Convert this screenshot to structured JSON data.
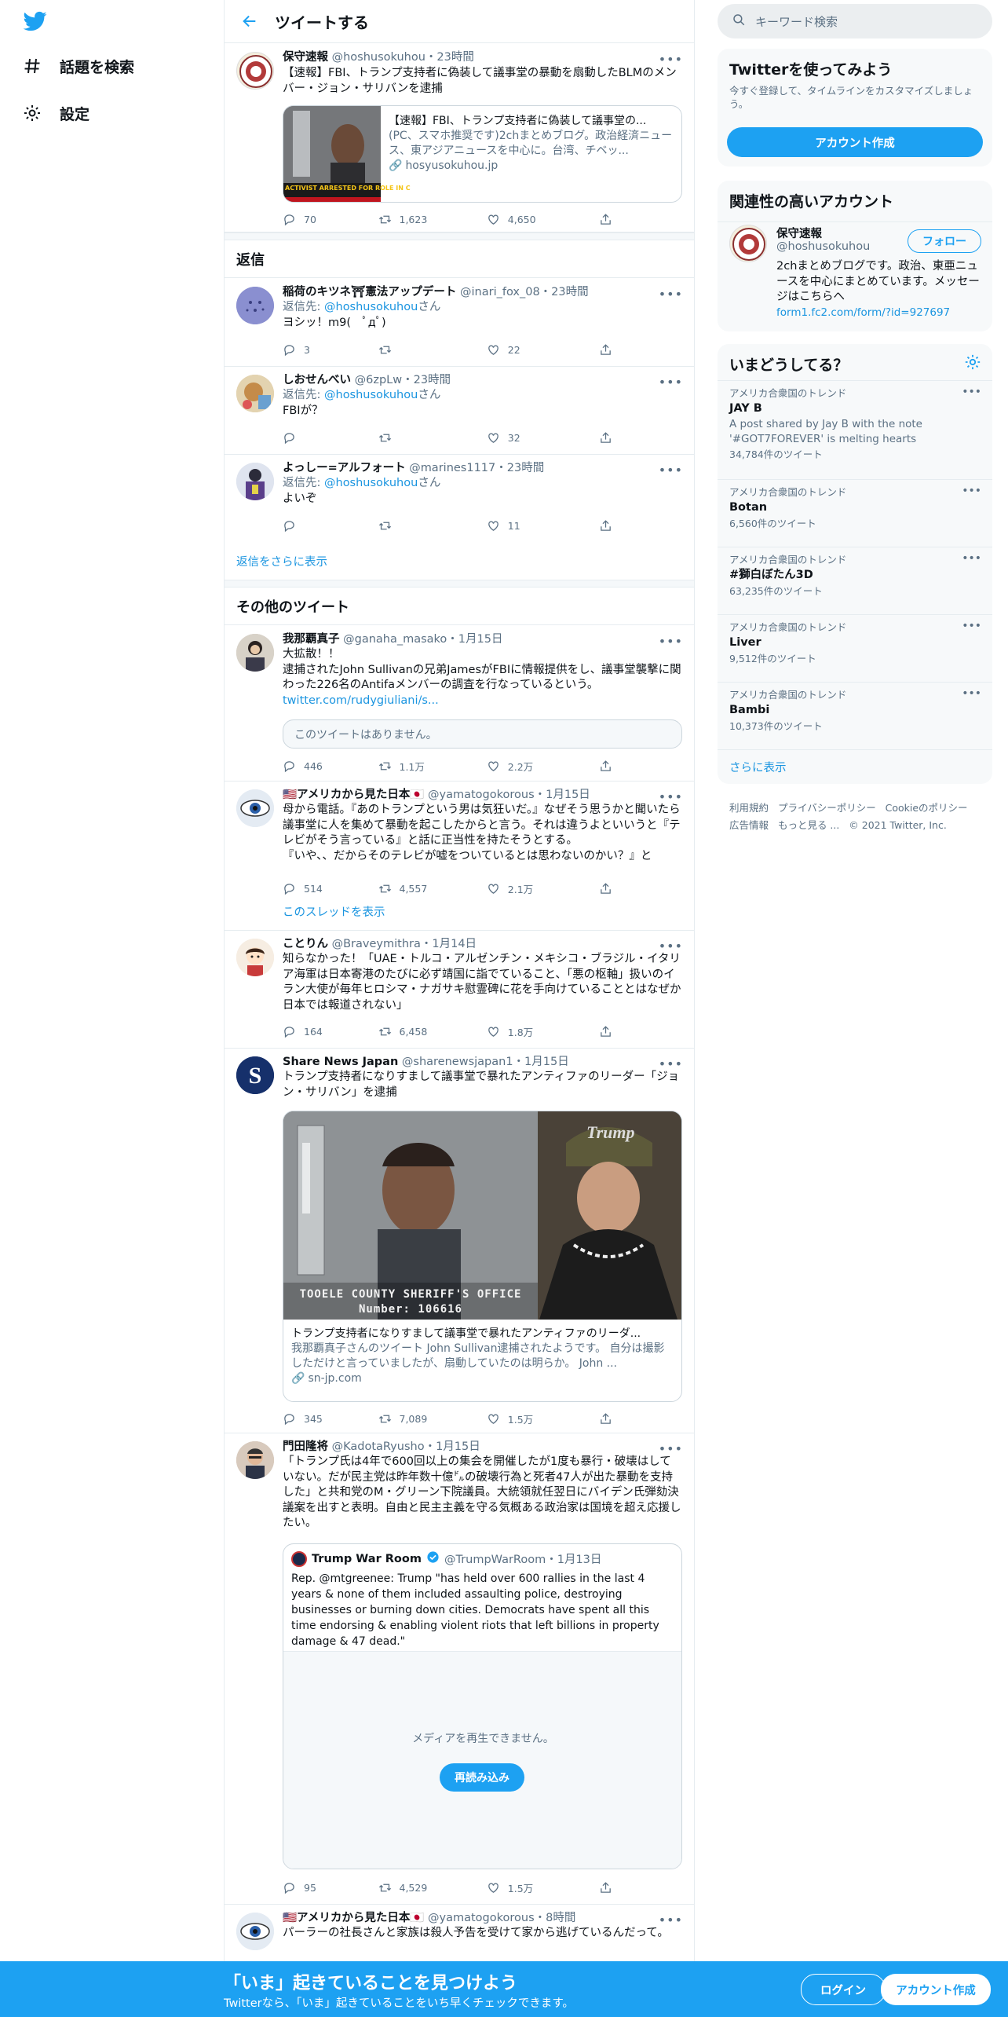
{
  "nav": {
    "explore": "話題を検索",
    "settings": "設定"
  },
  "header": {
    "title": "ツイートする"
  },
  "main_tweet": {
    "name": "保守速報",
    "handle": "@hoshusokuhou・23時間",
    "text": "【速報】FBI、トランプ支持者に偽装して議事堂の暴動を扇動したBLMのメンバー・ジョン・サリバンを逮捕",
    "card_title": "【速報】FBI、トランプ支持者に偽装して議事堂の...",
    "card_desc": "(PC、スマホ推奨です)2chまとめブログ。政治経済ニュース、東アジアニュースを中心に。台湾、チベッ...",
    "card_domain": "hosyusokuhou.jp",
    "card_image_caption": "ACTIVIST ARRESTED FOR ROLE IN C",
    "replies": "70",
    "retweets": "1,623",
    "likes": "4,650"
  },
  "replies_section": {
    "title": "返信",
    "show_more": "返信をさらに表示"
  },
  "replies": [
    {
      "name": "稲荷のキツネ⛩憲法アップデート",
      "handle": "@inari_fox_08・23時間",
      "reply_prefix": "返信先: ",
      "reply_to": "@hoshusokuhou",
      "reply_suffix": "さん",
      "text": "ヨシッ！m9(　ﾟдﾟ)",
      "replies": "3",
      "retweets": "",
      "likes": "22"
    },
    {
      "name": "しおせんべい",
      "handle": "@6zpLw・23時間",
      "reply_prefix": "返信先: ",
      "reply_to": "@hoshusokuhou",
      "reply_suffix": "さん",
      "text": "FBIが？",
      "replies": "",
      "retweets": "",
      "likes": "32"
    },
    {
      "name": "よっしー=アルフォート",
      "handle": "@marines1117・23時間",
      "reply_prefix": "返信先: ",
      "reply_to": "@hoshusokuhou",
      "reply_suffix": "さん",
      "text": "よいぞ",
      "replies": "",
      "retweets": "",
      "likes": "11"
    }
  ],
  "others_section": {
    "title": "その他のツイート"
  },
  "other_tweets": [
    {
      "name": "我那覇真子",
      "handle": "@ganaha_masako・1月15日",
      "text": "大拡散！！\n逮捕されたJohn Sullivanの兄弟JamesがFBIに情報提供をし、議事堂襲撃に関わった226名のAntifaメンバーの調査を行なっているという。",
      "link": "twitter.com/rudygiuliani/s...",
      "unavailable": "このツイートはありません。",
      "replies": "446",
      "retweets": "1.1万",
      "likes": "2.2万"
    },
    {
      "name": "🇺🇸アメリカから見た日本🇯🇵",
      "handle": "@yamatogokorous・1月15日",
      "text": "母から電話。『あのトランプという男は気狂いだ。』なぜそう思うかと聞いたら議事堂に人を集めて暴動を起こしたからと言う。それは違うよといいうと『テレビがそう言っている』と話に正当性を持たそうとする。\n『いや、、だからそのテレビが嘘をついているとは思わないのかい？』と",
      "replies": "514",
      "retweets": "4,557",
      "likes": "2.1万",
      "thread": "このスレッドを表示"
    },
    {
      "name": "ことりん",
      "handle": "@Braveymithra・1月14日",
      "text": "知らなかった！「UAE・トルコ・アルゼンチン・メキシコ・ブラジル・イタリア海軍は日本寄港のたびに必ず靖国に詣でていること、「悪の枢軸」扱いのイラン大使が毎年ヒロシマ・ナガサキ慰霊碑に花を手向けていることとはなぜか日本では報道されない」",
      "replies": "164",
      "retweets": "6,458",
      "likes": "1.8万"
    },
    {
      "name": "Share News Japan",
      "handle": "@sharenewsjapan1・1月15日",
      "text": "トランプ支持者になりすまして議事堂で暴れたアンティファのリーダー「ジョン・サリバン」を逮捕",
      "card_title": "トランプ支持者になりすまして議事堂で暴れたアンティファのリーダ...",
      "card_desc": "我那覇真子さんのツイート John Sullivan逮捕されたようです。 自分は撮影しただけと言っていましたが、扇動していたのは明らか。 John ...",
      "card_domain": "sn-jp.com",
      "mug_line1": "TOOELE COUNTY SHERIFF'S OFFICE",
      "mug_line2": "Number: 106616",
      "cap_text": "Trump",
      "replies": "345",
      "retweets": "7,089",
      "likes": "1.5万"
    },
    {
      "name": "門田隆将",
      "handle": "@KadotaRyusho・1月15日",
      "text": "「トランプ氏は4年で600回以上の集会を開催したが1度も暴行・破壊はしていない。だが民主党は昨年数十億㌦の破壊行為と死者47人が出た暴動を支持した」と共和党のM・グリーン下院議員。大統領就任翌日にバイデン氏弾劾決議案を出すと表明。自由と民主主義を守る気概ある政治家は国境を超え応援したい。",
      "quote_name": "Trump War Room",
      "quote_handle": "@TrumpWarRoom・1月13日",
      "quote_text": "Rep. @mtgreenee: Trump \"has held over 600 rallies in the last 4 years & none of them included assaulting police, destroying businesses or burning down cities. Democrats have spent all this time endorsing & enabling violent riots that left billions in property damage & 47 dead.\"",
      "media_error": "メディアを再生できません。",
      "reload": "再読み込み",
      "replies": "95",
      "retweets": "4,529",
      "likes": "1.5万"
    },
    {
      "name": "🇺🇸アメリカから見た日本🇯🇵",
      "handle": "@yamatogokorous・8時間",
      "text": "パーラーの社長さんと家族は殺人予告を受けて家から逃げているんだって。"
    }
  ],
  "search": {
    "placeholder": "キーワード検索"
  },
  "signup": {
    "title": "Twitterを使ってみよう",
    "desc": "今すぐ登録して、タイムラインをカスタマイズしましょう。",
    "button": "アカウント作成"
  },
  "related": {
    "title": "関連性の高いアカウント",
    "name": "保守速報",
    "handle": "@hoshusokuhou",
    "follow": "フォロー",
    "bio": "2chまとめブログです。政治、東亜ニュースを中心にまとめています。メッセージはこちらへ",
    "link": "form1.fc2.com/form/?id=927697"
  },
  "trends": {
    "title": "いまどうしてる？",
    "items": [
      {
        "context": "アメリカ合衆国のトレンド",
        "name": "JAY B",
        "desc": "A post shared by Jay B with the note '#GOT7FOREVER' is melting hearts",
        "count": "34,784件のツイート"
      },
      {
        "context": "アメリカ合衆国のトレンド",
        "name": "Botan",
        "count": "6,560件のツイート"
      },
      {
        "context": "アメリカ合衆国のトレンド",
        "name": "#獅白ぼたん3D",
        "count": "63,235件のツイート"
      },
      {
        "context": "アメリカ合衆国のトレンド",
        "name": "Liver",
        "count": "9,512件のツイート"
      },
      {
        "context": "アメリカ合衆国のトレンド",
        "name": "Bambi",
        "count": "10,373件のツイート"
      }
    ],
    "show_more": "さらに表示"
  },
  "footer": {
    "terms": "利用規約",
    "privacy": "プライバシーポリシー",
    "cookie": "Cookieのポリシー",
    "ads": "広告情報",
    "more": "もっと見る ...",
    "copyright": "© 2021 Twitter, Inc."
  },
  "bottom": {
    "title": "「いま」起きていることを見つけよう",
    "sub": "Twitterなら、「いま」起きていることをいち早くチェックできます。",
    "login": "ログイン",
    "signup": "アカウント作成"
  },
  "colors": {
    "accent": "#1da1f2",
    "link": "#1b95e0",
    "muted": "#5b7083",
    "border": "#e6ecf0"
  }
}
